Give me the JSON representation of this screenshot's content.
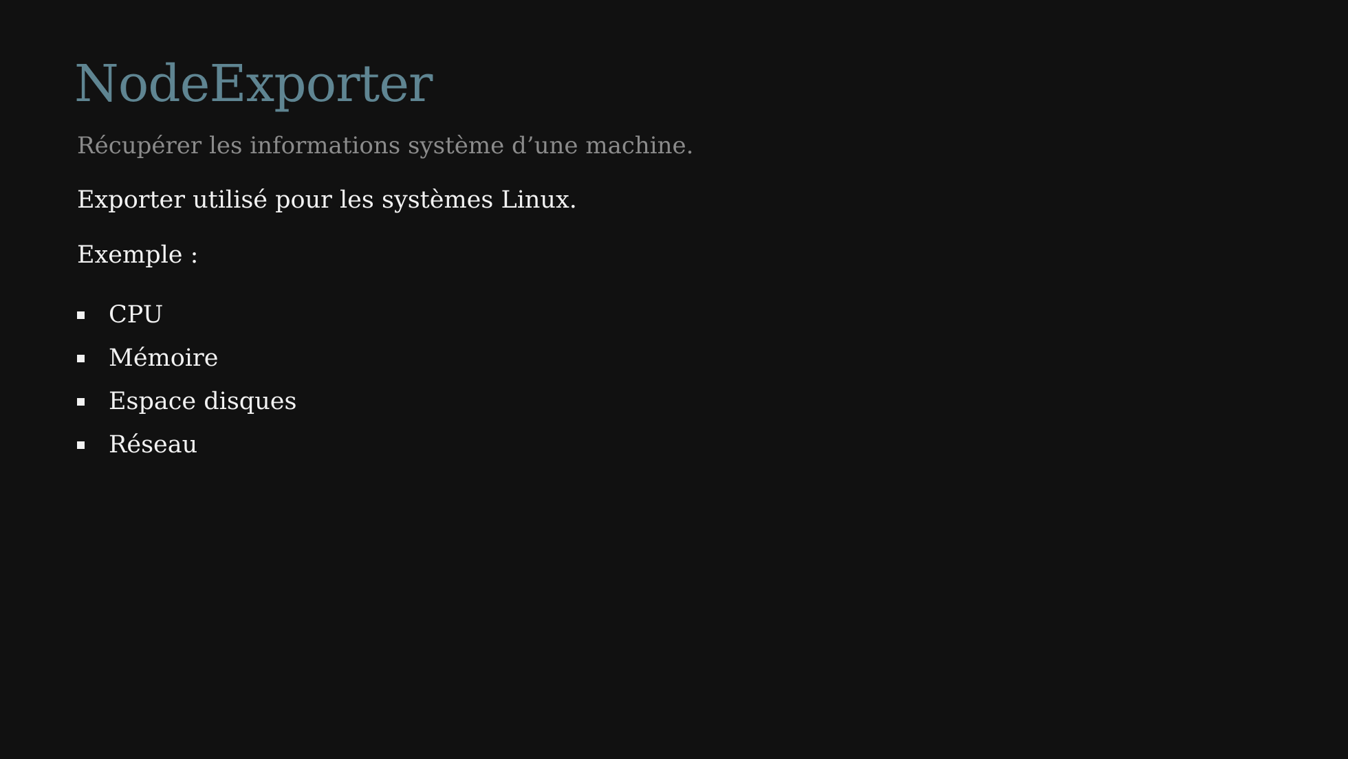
{
  "slide": {
    "title": "NodeExporter",
    "subtitle": "Récupérer les informations système d’une machine.",
    "description": "Exporter utilisé pour les systèmes Linux.",
    "example_label": "Exemple :",
    "items": [
      {
        "label": "CPU",
        "icon": "square-bullet-icon"
      },
      {
        "label": "Mémoire",
        "icon": "square-bullet-icon"
      },
      {
        "label": "Espace disques",
        "icon": "square-bullet-icon"
      },
      {
        "label": "Réseau",
        "icon": "square-bullet-icon"
      }
    ],
    "colors": {
      "background": "#111111",
      "title": "#5f8592",
      "subtitle": "#8b8b8b",
      "text": "#f2f2f2"
    }
  }
}
